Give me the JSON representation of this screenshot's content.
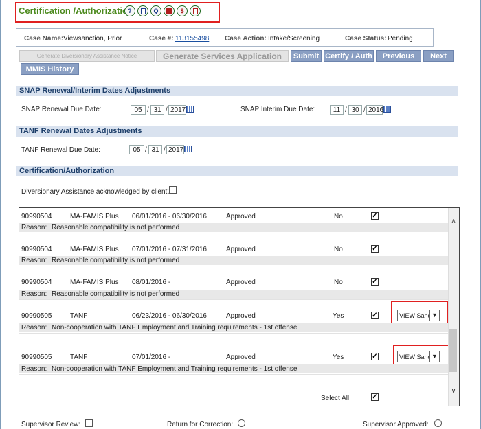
{
  "page": {
    "title": "Certification /Authorization",
    "icons": [
      "help-icon",
      "notes-icon",
      "question-icon",
      "stop-icon",
      "info-icon",
      "edit-icon"
    ],
    "help_glyph": "?",
    "question_glyph": "Q",
    "info_glyph": "$"
  },
  "case": {
    "name_label": "Case Name:",
    "name_value": "Viewsanction, Prior",
    "number_label": "Case #:",
    "number_value": "113155498",
    "action_label": "Case Action:",
    "action_value": "Intake/Screening",
    "status_label": "Case Status:",
    "status_value": "Pending"
  },
  "buttons": {
    "diversionary": "Generate Diversionary Assistance Notice",
    "services": "Generate Services Application",
    "submit": "Submit",
    "certify": "Certify / Auth",
    "previous": "Previous",
    "next": "Next",
    "mmis": "MMIS History"
  },
  "snap": {
    "header": "SNAP Renewal/Interim Dates Adjustments",
    "renewal_label": "SNAP Renewal Due Date:",
    "renewal_mm": "05",
    "renewal_dd": "31",
    "renewal_yyyy": "2017",
    "interim_label": "SNAP Interim Due Date:",
    "interim_mm": "11",
    "interim_dd": "30",
    "interim_yyyy": "2016"
  },
  "tanf": {
    "header": "TANF Renewal Dates Adjustments",
    "renewal_label": "TANF Renewal Due Date:",
    "renewal_mm": "05",
    "renewal_dd": "31",
    "renewal_yyyy": "2017"
  },
  "cert": {
    "header": "Certification/Authorization",
    "diversionary_label": "Diversionary Assistance acknowledged by client?:",
    "rows": [
      {
        "id": "90990504",
        "program": "MA-FAMIS Plus",
        "dates": "06/01/2016 - 06/30/2016",
        "status": "Approved",
        "flag": "No",
        "reason_label": "Reason:",
        "reason": "Reasonable compatibility is not performed"
      },
      {
        "id": "90990504",
        "program": "MA-FAMIS Plus",
        "dates": "07/01/2016 - 07/31/2016",
        "status": "Approved",
        "flag": "No",
        "reason_label": "Reason:",
        "reason": "Reasonable compatibility is not performed"
      },
      {
        "id": "90990504",
        "program": "MA-FAMIS Plus",
        "dates": "08/01/2016 -",
        "status": "Approved",
        "flag": "No",
        "reason_label": "Reason:",
        "reason": "Reasonable compatibility is not performed"
      },
      {
        "id": "90990505",
        "program": "TANF",
        "dates": "06/23/2016 - 06/30/2016",
        "status": "Approved",
        "flag": "Yes",
        "reason_label": "Reason:",
        "reason": "Non-cooperation with TANF Employment and Training requirements - 1st offense",
        "select": "VIEW Sanction"
      },
      {
        "id": "90990505",
        "program": "TANF",
        "dates": "07/01/2016 -",
        "status": "Approved",
        "flag": "Yes",
        "reason_label": "Reason:",
        "reason": "Non-cooperation with TANF Employment and Training requirements - 1st offense",
        "select": "VIEW Sanction"
      }
    ],
    "check_glyph": "✓",
    "select_all": "Select All"
  },
  "footer": {
    "supervisor_review": "Supervisor Review:",
    "return_correction": "Return for Correction:",
    "supervisor_approved": "Supervisor Approved:"
  }
}
